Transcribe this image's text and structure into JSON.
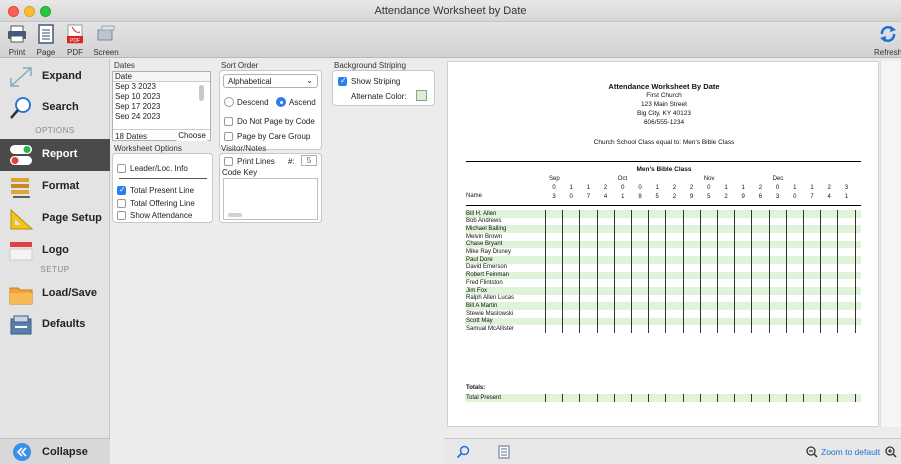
{
  "window": {
    "title": "Attendance Worksheet by Date"
  },
  "toolbar": {
    "print_label": "Print",
    "page_label": "Page",
    "pdf_label": "PDF",
    "screen_label": "Screen",
    "refresh_label": "Refresh",
    "pdf_icon_text": "PDF"
  },
  "sidebar": {
    "expand": "Expand",
    "search": "Search",
    "options_section": "OPTIONS",
    "report": "Report",
    "format": "Format",
    "page_setup": "Page Setup",
    "logo": "Logo",
    "setup_section": "SETUP",
    "load_save": "Load/Save",
    "defaults": "Defaults",
    "collapse": "Collapse"
  },
  "dates": {
    "group_title": "Dates",
    "header": "Date",
    "items": [
      "Sep 3 2023",
      "Sep 10 2023",
      "Sep 17 2023",
      "Sep 24 2023"
    ],
    "count": "18 Dates",
    "choose_label": "Choose"
  },
  "sort": {
    "group_title": "Sort Order",
    "selected": "Alphabetical",
    "descend": "Descend",
    "ascend": "Ascend",
    "no_page_by_code": "Do Not Page by Code",
    "page_by_care_group": "Page by Care Group"
  },
  "striping": {
    "group_title": "Background Striping",
    "show_striping": "Show Striping",
    "alternate_color": "Alternate Color:",
    "alt_color_hex": "#d8f0cf"
  },
  "worksheet": {
    "group_title": "Worksheet Options",
    "leader_info": "Leader/Loc. Info",
    "total_present": "Total Present Line",
    "total_offering": "Total Offering Line",
    "show_attendance": "Show Attendance"
  },
  "visitor": {
    "group_title": "Visitor/Notes",
    "print_lines": "Print Lines",
    "hash": "#:",
    "lines_value": "5",
    "code_key": "Code Key"
  },
  "report": {
    "title": "Attendance Worksheet By Date",
    "org": "First Church",
    "address": "123 Main Street",
    "city": "Big City, KY  40123",
    "phone": "606/555-1234",
    "filter": "Church School Class equal to: Men's Bible Class",
    "class_name": "Men's Bible Class",
    "name_header": "Name",
    "months": [
      "Sep",
      "Oct",
      "Nov",
      "Dec"
    ],
    "date_cols": [
      [
        "0",
        "3"
      ],
      [
        "1",
        "0"
      ],
      [
        "1",
        "7"
      ],
      [
        "2",
        "4"
      ],
      [
        "0",
        "1"
      ],
      [
        "0",
        "8"
      ],
      [
        "1",
        "5"
      ],
      [
        "2",
        "2"
      ],
      [
        "2",
        "9"
      ],
      [
        "0",
        "5"
      ],
      [
        "1",
        "2"
      ],
      [
        "1",
        "9"
      ],
      [
        "2",
        "6"
      ],
      [
        "0",
        "3"
      ],
      [
        "1",
        "0"
      ],
      [
        "1",
        "7"
      ],
      [
        "2",
        "4"
      ],
      [
        "3",
        "1"
      ]
    ],
    "names": [
      "Bill H. Allen",
      "Bob Andrews",
      "Michael Balling",
      "Melvin Brown",
      "Chase Bryant",
      "Mike Ray Disney",
      "Paul Dore",
      "David Emerson",
      "Robert Feinman",
      "Fred Flintston",
      "Jim Fox",
      "Ralph Allen Lucas",
      "Bill A Martin",
      "Stewie Maslowski",
      "Scott May",
      "Samual McAllister"
    ],
    "totals_label": "Totals:",
    "total_present": "Total Present"
  },
  "bottom": {
    "zoom_label": "Zoom to default"
  }
}
